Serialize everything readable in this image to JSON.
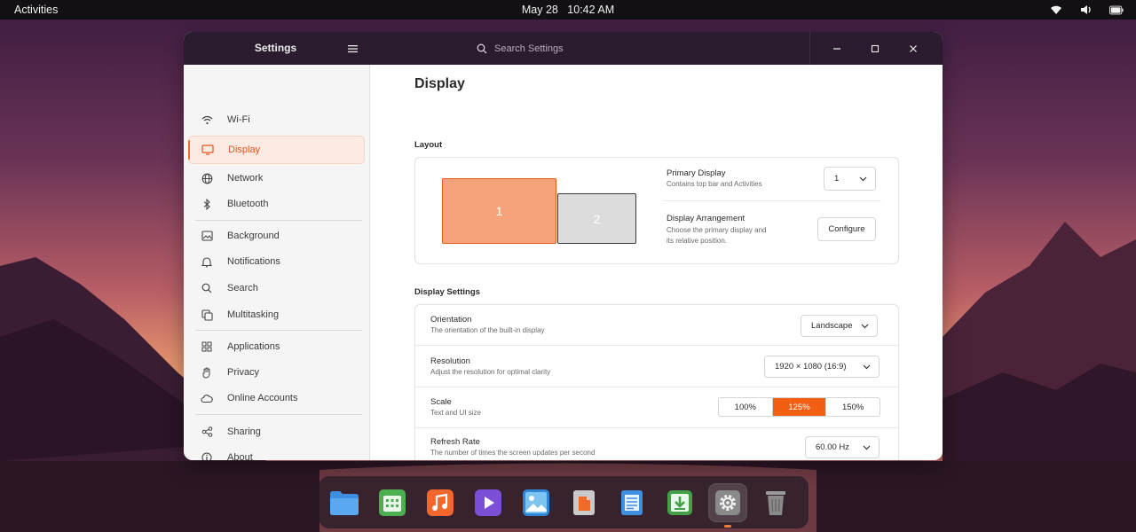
{
  "topbar": {
    "activities_label": "Activities",
    "date": "May 28",
    "time": "10:42 AM",
    "tray_icons": [
      "wifi-icon",
      "volume-icon",
      "battery-icon"
    ]
  },
  "window": {
    "title": "Settings",
    "search_placeholder": "Search Settings",
    "controls": [
      "minimize-icon",
      "maximize-icon",
      "close-icon"
    ]
  },
  "sidebar": {
    "items": [
      {
        "label": "Wi-Fi",
        "icon": "wifi-icon"
      },
      {
        "label": "Display",
        "icon": "monitor-icon",
        "active": true
      },
      {
        "label": "Network",
        "icon": "globe-icon"
      },
      {
        "label": "Bluetooth",
        "icon": "bluetooth-icon"
      },
      {
        "label": "Background",
        "icon": "image-icon"
      },
      {
        "label": "Notifications",
        "icon": "bell-icon"
      },
      {
        "label": "Search",
        "icon": "search-icon"
      },
      {
        "label": "Multitasking",
        "icon": "windows-icon"
      },
      {
        "label": "Applications",
        "icon": "grid-icon"
      },
      {
        "label": "Privacy",
        "icon": "hand-icon"
      },
      {
        "label": "Online Accounts",
        "icon": "cloud-icon"
      },
      {
        "label": "Sharing",
        "icon": "share-icon"
      },
      {
        "label": "About",
        "icon": "info-icon"
      }
    ]
  },
  "main": {
    "title": "Display",
    "layout": {
      "section_title": "Layout",
      "monitors": [
        "1",
        "2"
      ],
      "primary_display": {
        "title": "Primary Display",
        "subtitle": "Contains top bar and Activities",
        "value": "1"
      },
      "arrangement": {
        "title": "Display Arrangement",
        "subtitle_line1": "Choose the primary display and",
        "subtitle_line2": "its relative position.",
        "button_label": "Configure"
      }
    },
    "display_settings": {
      "section_title": "Display Settings",
      "orientation": {
        "title": "Orientation",
        "subtitle": "The orientation of the built-in display",
        "value": "Landscape"
      },
      "resolution": {
        "title": "Resolution",
        "subtitle": "Adjust the resolution for optimal clarity",
        "value": "1920 × 1080 (16:9)"
      },
      "scale": {
        "title": "Scale",
        "subtitle": "Text and UI size",
        "options": [
          "100%",
          "125%",
          "150%"
        ],
        "selected": "125%"
      },
      "refresh_rate": {
        "title": "Refresh Rate",
        "subtitle": "The number of times the screen updates per second",
        "value": "60.00 Hz"
      }
    }
  },
  "dock": {
    "apps": [
      "files-icon",
      "calendar-icon",
      "music-icon",
      "video-icon",
      "photos-icon",
      "documents-icon",
      "text-editor-icon",
      "software-download-icon",
      "settings-gear-icon",
      "trash-icon"
    ],
    "active_app": "settings-gear-icon"
  },
  "colors": {
    "accent": "#f25f12",
    "topbar": "#121012",
    "titlebar": "#2b1b2f"
  }
}
